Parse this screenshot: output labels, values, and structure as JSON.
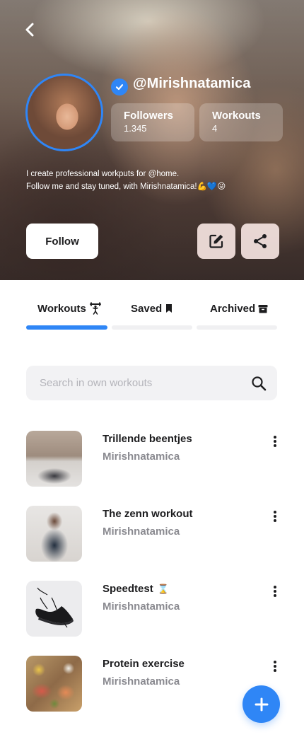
{
  "profile": {
    "username": "@Mirishnatamica",
    "verified": true,
    "stats": [
      {
        "label": "Followers",
        "value": "1.345"
      },
      {
        "label": "Workouts",
        "value": "4"
      }
    ],
    "bio_lines": [
      "I create professional workputs for @home.",
      "Follow me and stay tuned, with Mirishnatamica!💪💙😜"
    ],
    "follow_label": "Follow",
    "icons": {
      "back": "back-chevron-icon",
      "verified": "verified-check-icon",
      "edit": "edit-icon",
      "share": "share-icon"
    }
  },
  "tabs": [
    {
      "label": "Workouts",
      "icon": "dumbbell-icon",
      "active": true
    },
    {
      "label": "Saved",
      "icon": "bookmark-icon",
      "active": false
    },
    {
      "label": "Archived",
      "icon": "archive-box-icon",
      "active": false
    }
  ],
  "search": {
    "placeholder": "Search in own workouts",
    "value": "",
    "icon": "search-icon"
  },
  "workouts": [
    {
      "title": "Trillende beentjes",
      "author": "Mirishnatamica",
      "title_icon": ""
    },
    {
      "title": "The zenn workout",
      "author": "Mirishnatamica",
      "title_icon": ""
    },
    {
      "title": "Speedtest",
      "author": "Mirishnatamica",
      "title_icon": "⌛"
    },
    {
      "title": "Protein exercise",
      "author": "Mirishnatamica",
      "title_icon": ""
    }
  ],
  "fab": {
    "icon": "plus-icon"
  },
  "colors": {
    "accent": "#2f86f6",
    "text": "#1d1d1f",
    "muted": "#8a8a90",
    "surface": "#f2f2f4"
  }
}
